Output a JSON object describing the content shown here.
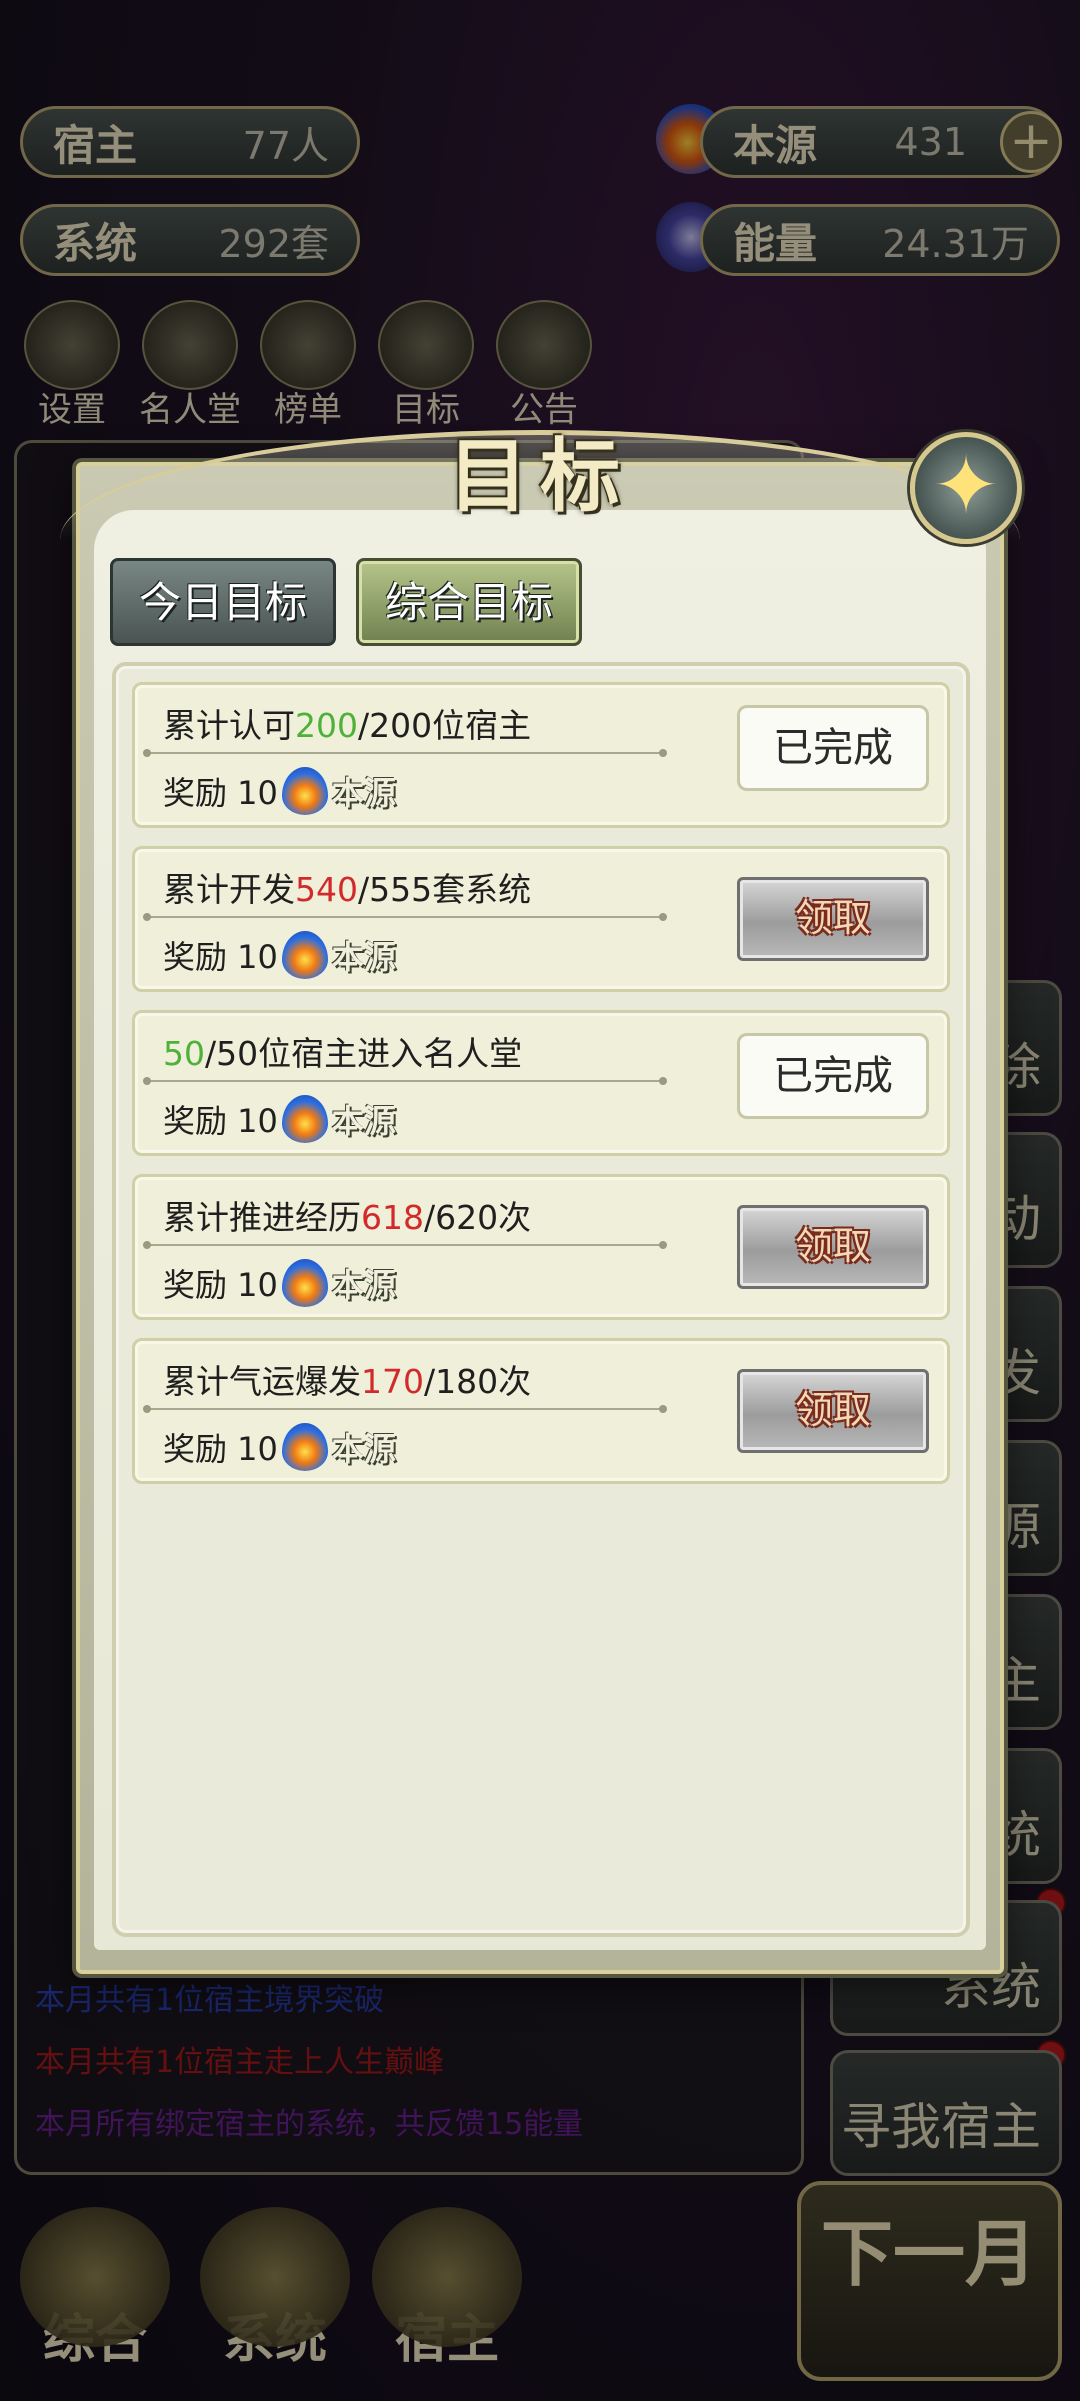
{
  "header": {
    "host": {
      "label": "宿主",
      "value": "77人"
    },
    "system": {
      "label": "系统",
      "value": "292套"
    },
    "source": {
      "label": "本源",
      "value": "431"
    },
    "energy": {
      "label": "能量",
      "value": "24.31万"
    }
  },
  "top_menu": [
    "设置",
    "名人堂",
    "榜单",
    "目标",
    "公告"
  ],
  "log_lines": [
    {
      "text": "本月共有1位宿主境界突破",
      "color": "#2b3fb0"
    },
    {
      "text": "本月共有1位宿主走上人生巅峰",
      "color": "#a21b1b"
    },
    {
      "text": "本月所有绑定宿主的系统，共反馈15能量",
      "color": "#6a1f8f"
    }
  ],
  "side_buttons": [
    "除",
    "动",
    "发",
    "源",
    "主",
    "统",
    "系统",
    "寻我宿主"
  ],
  "bottom_nav": [
    "综合",
    "系统",
    "宿主"
  ],
  "next_month": "下一月",
  "modal": {
    "title": "目标",
    "tabs": [
      "今日目标",
      "综合目标"
    ],
    "goals": [
      {
        "pre": "累计认可",
        "num": "200",
        "post": "/200位宿主",
        "num_state": "done",
        "reward_label": "奖励 10",
        "currency": "本源",
        "status": "已完成",
        "claimable": false
      },
      {
        "pre": "累计开发",
        "num": "540",
        "post": "/555套系统",
        "num_state": "prog",
        "reward_label": "奖励 10",
        "currency": "本源",
        "status": "领取",
        "claimable": true
      },
      {
        "pre": "",
        "num": "50",
        "post": "/50位宿主进入名人堂",
        "num_state": "done",
        "reward_label": "奖励 10",
        "currency": "本源",
        "status": "已完成",
        "claimable": false
      },
      {
        "pre": "累计推进经历",
        "num": "618",
        "post": "/620次",
        "num_state": "prog",
        "reward_label": "奖励 10",
        "currency": "本源",
        "status": "领取",
        "claimable": true
      },
      {
        "pre": "累计气运爆发",
        "num": "170",
        "post": "/180次",
        "num_state": "prog",
        "reward_label": "奖励 10",
        "currency": "本源",
        "status": "领取",
        "claimable": true
      }
    ]
  },
  "colors": {
    "done": "#4db13a",
    "progress": "#d22a2a"
  }
}
